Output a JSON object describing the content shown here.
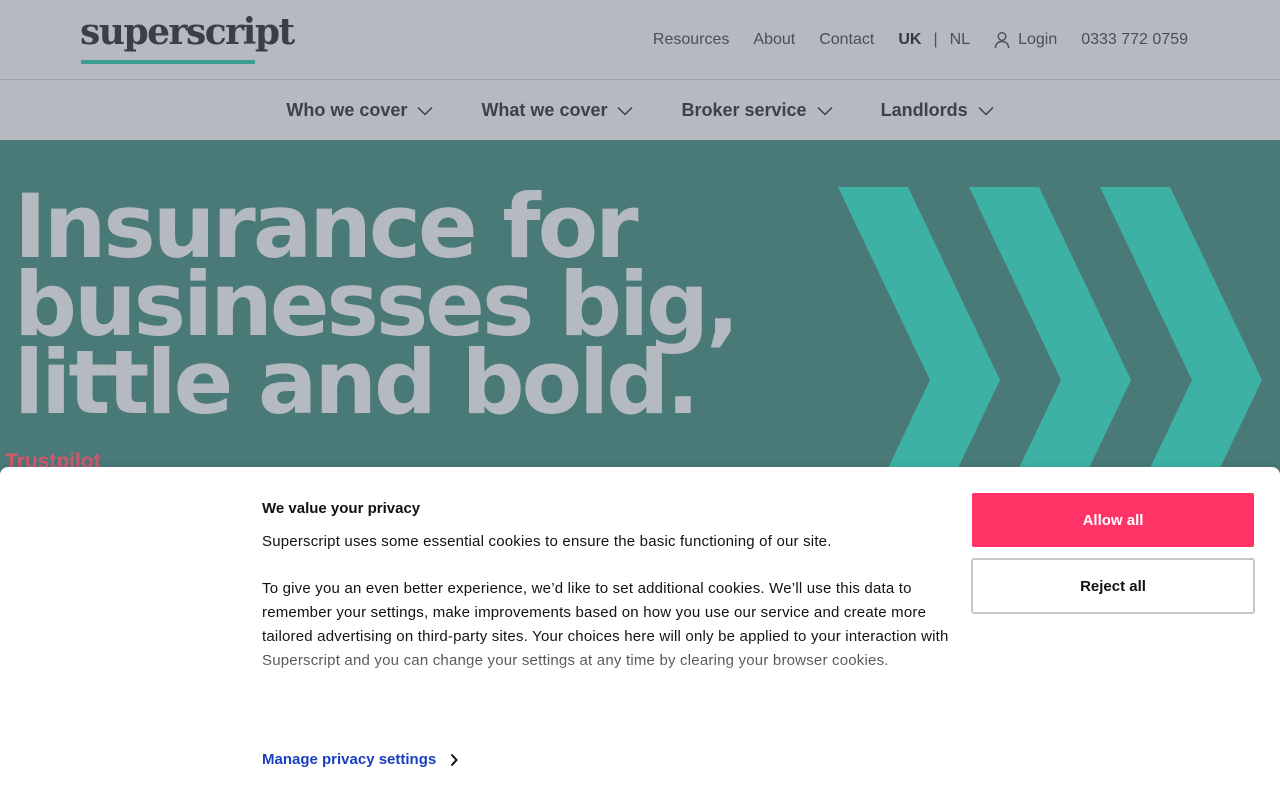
{
  "header": {
    "logo_text": "superscript",
    "nav": {
      "resources": "Resources",
      "about": "About",
      "contact": "Contact",
      "lang_uk": "UK",
      "lang_sep": "|",
      "lang_nl": "NL",
      "login": "Login",
      "phone": "0333 772 0759"
    }
  },
  "main_nav": {
    "items": [
      {
        "label": "Who we cover"
      },
      {
        "label": "What we cover"
      },
      {
        "label": "Broker service"
      },
      {
        "label": "Landlords"
      }
    ]
  },
  "hero": {
    "line1": "Insurance for",
    "line2": "businesses big,",
    "line3": "little and bold.",
    "trustpilot": "Trustpilot"
  },
  "cookie_banner": {
    "title": "We value your privacy",
    "paragraph1": "Superscript uses some essential cookies to ensure the basic functioning of our site.",
    "paragraph2": "To give you an even better experience, we’d like to set additional cookies. We’ll use this data to remember your settings, make improvements based on how you use our service and create more tailored advertising on third-party sites. Your choices here will only be applied to your interaction with Superscript and you can change your settings at any time by clearing your browser cookies.",
    "manage_label": "Manage privacy settings",
    "allow_label": "Allow all",
    "reject_label": "Reject all"
  },
  "colors": {
    "brand_teal": "#3a9e91",
    "hero_bg": "#4a7a78",
    "chevron": "#3eb1a5",
    "allow_button": "#ff3366",
    "link_blue": "#1a3fbf"
  }
}
